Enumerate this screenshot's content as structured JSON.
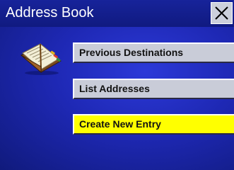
{
  "window": {
    "title": "Address Book",
    "close_icon": "close-x-icon"
  },
  "icon": {
    "name": "address-book-icon"
  },
  "menu": {
    "items": [
      {
        "label": "Previous Destinations",
        "highlighted": false
      },
      {
        "label": "List Addresses",
        "highlighted": false
      },
      {
        "label": "Create New Entry",
        "highlighted": true
      }
    ]
  },
  "colors": {
    "background": "#1e28b4",
    "button": "#c9ccd8",
    "highlight": "#ffff00"
  }
}
